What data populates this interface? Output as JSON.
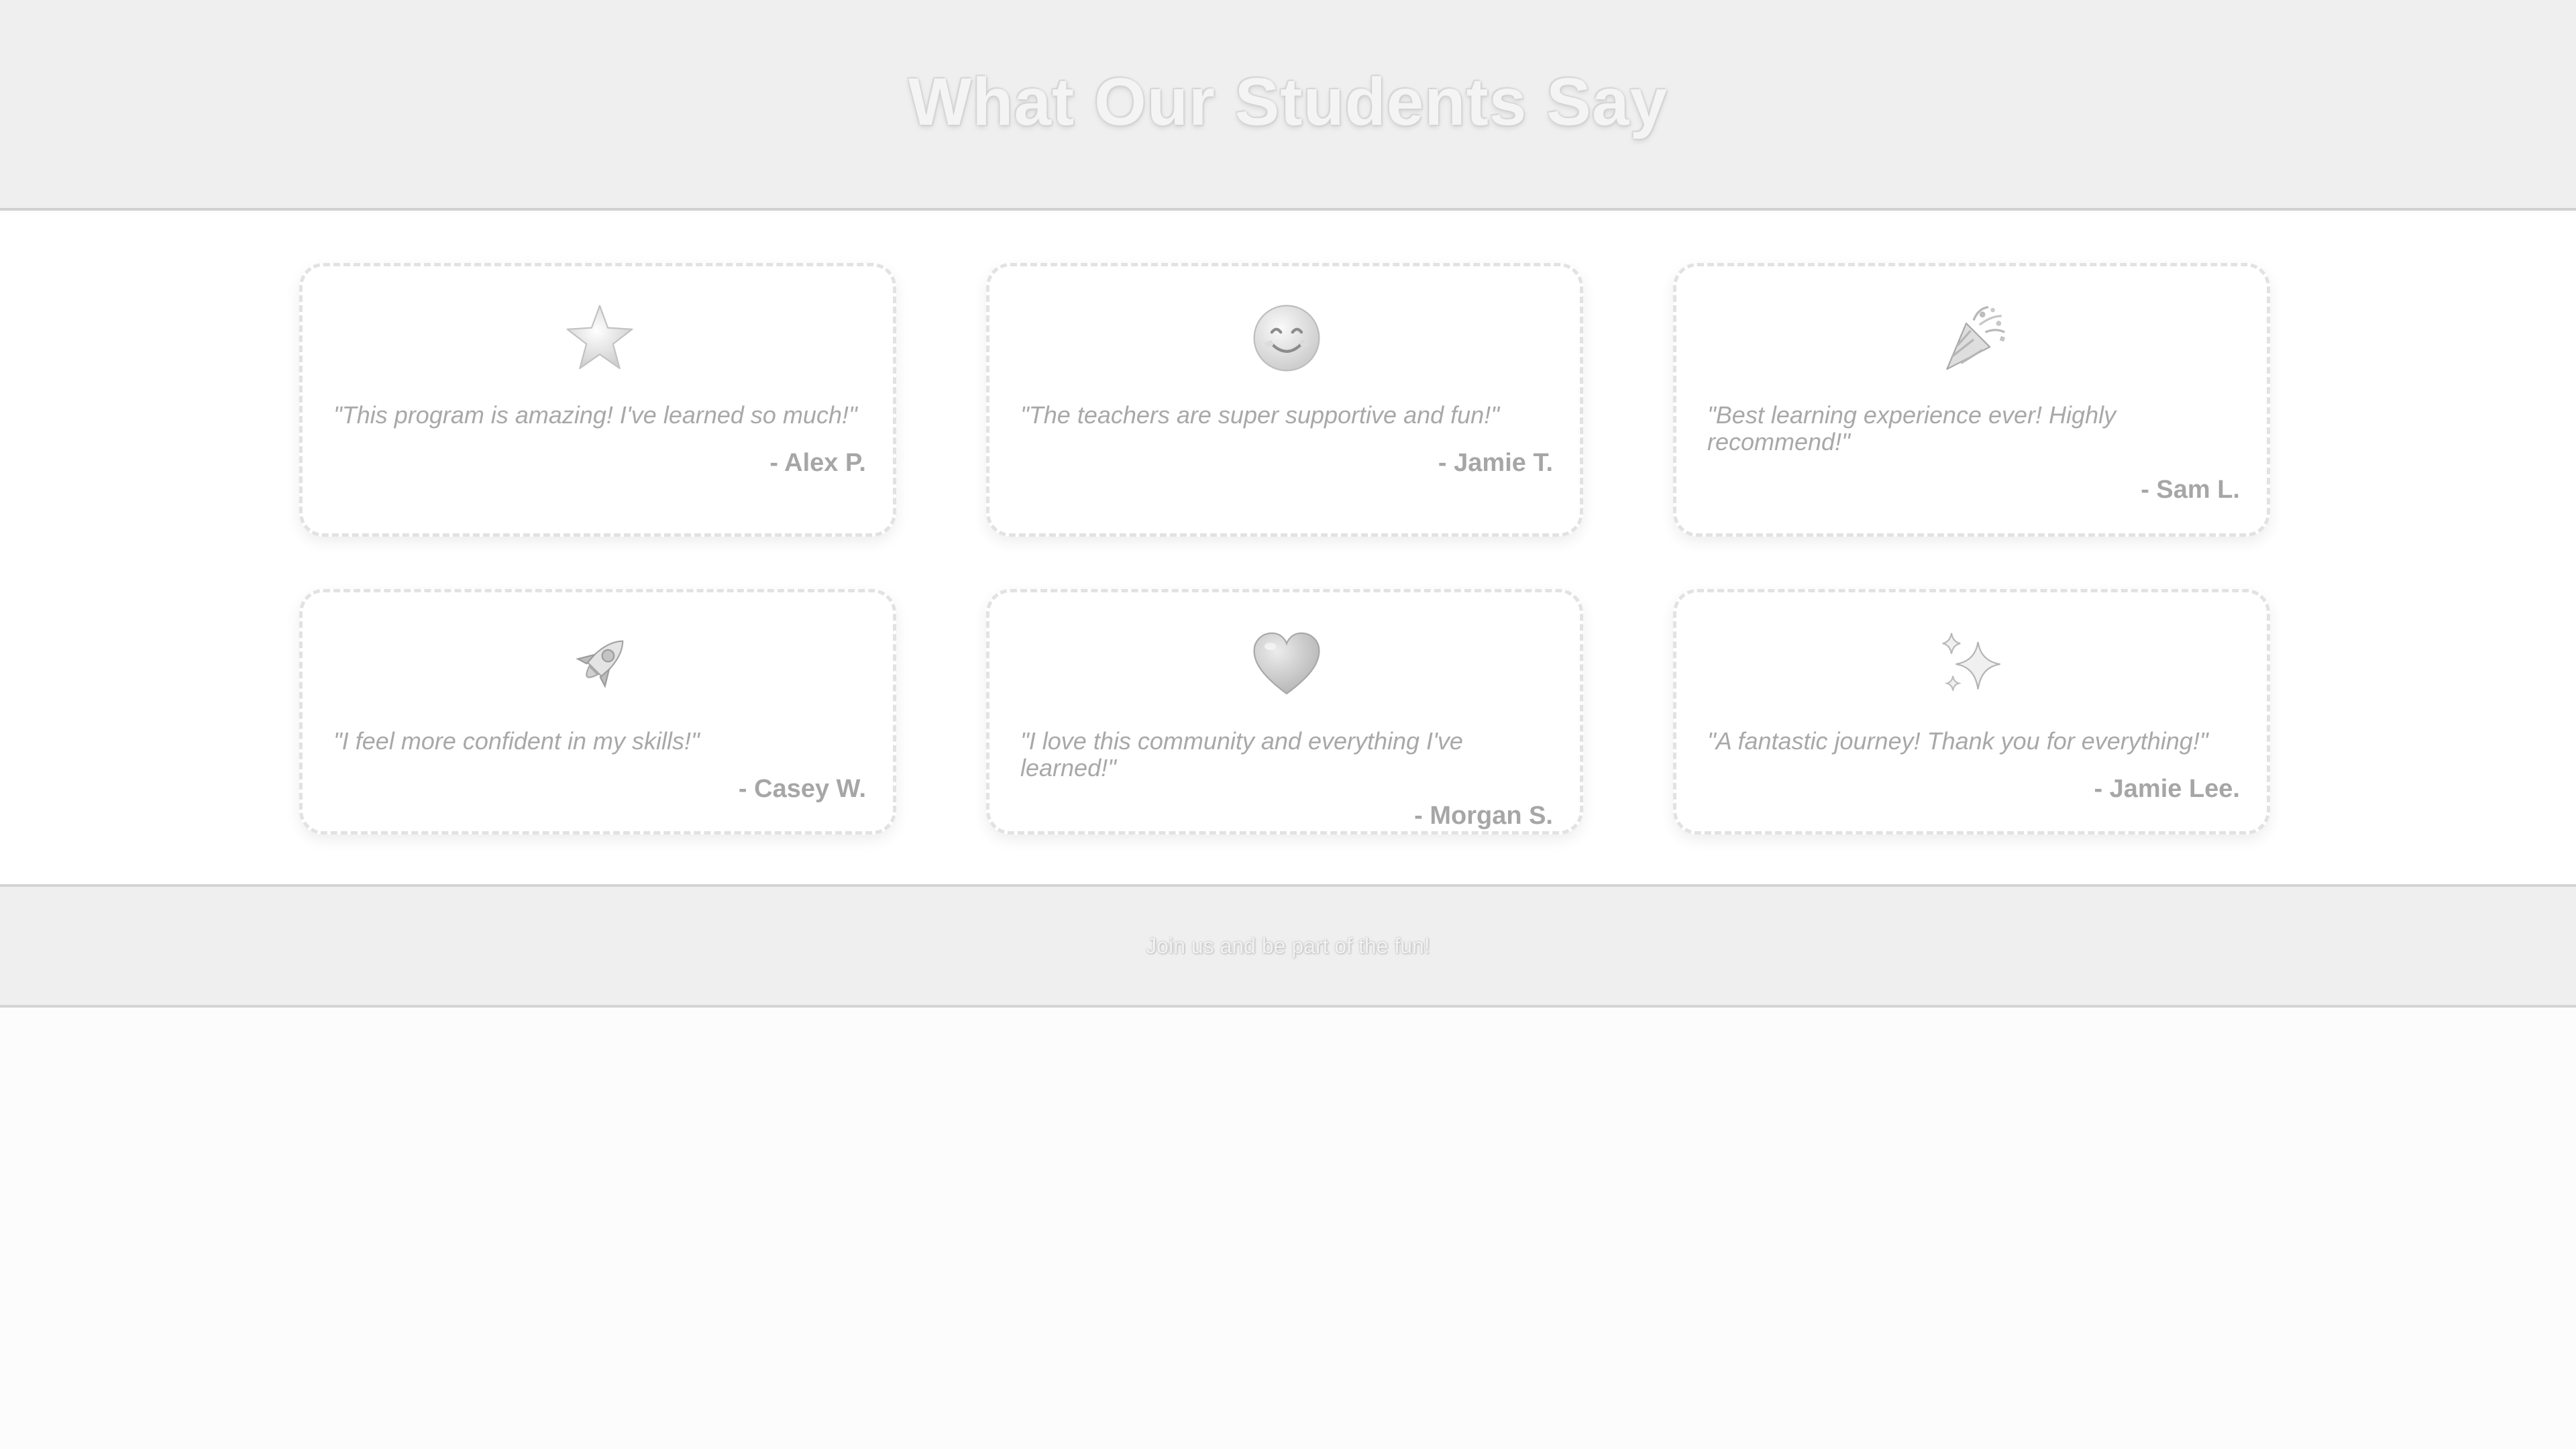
{
  "header": {
    "title": "What Our Students Say"
  },
  "testimonials": [
    {
      "icon": "star-icon",
      "quote": "\"This program is amazing! I've learned so much!\"",
      "author": "- Alex P."
    },
    {
      "icon": "smiling-face-icon",
      "quote": "\"The teachers are super supportive and fun!\"",
      "author": "- Jamie T."
    },
    {
      "icon": "party-popper-icon",
      "quote": "\"Best learning experience ever! Highly recommend!\"",
      "author": "- Sam L."
    },
    {
      "icon": "rocket-icon",
      "quote": "\"I feel more confident in my skills!\"",
      "author": "- Casey W."
    },
    {
      "icon": "heart-icon",
      "quote": "\"I love this community and everything I've learned!\"",
      "author": "- Morgan S."
    },
    {
      "icon": "sparkles-icon",
      "quote": "\"A fantastic journey! Thank you for everything!\"",
      "author": "- Jamie Lee."
    }
  ],
  "footer": {
    "text": "Join us and be part of the fun!"
  }
}
